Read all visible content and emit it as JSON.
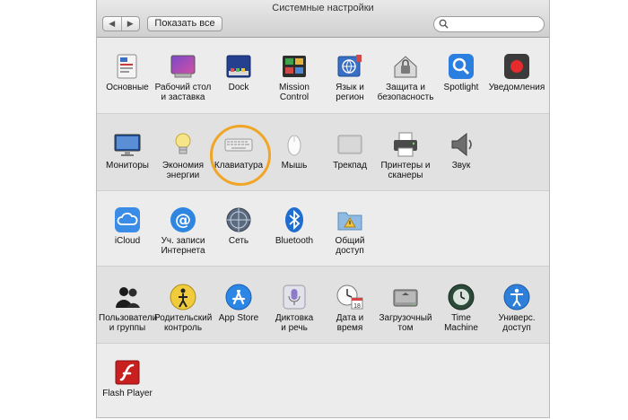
{
  "window": {
    "title": "Системные настройки"
  },
  "toolbar": {
    "back": "◀",
    "forward": "▶",
    "show_all": "Показать все"
  },
  "search": {
    "value": "",
    "placeholder": ""
  },
  "rows": [
    {
      "items": [
        {
          "label": "Основные"
        },
        {
          "label": "Рабочий стол\nи заставка"
        },
        {
          "label": "Dock"
        },
        {
          "label": "Mission\nControl"
        },
        {
          "label": "Язык и\nрегион"
        },
        {
          "label": "Защита и\nбезопасность"
        },
        {
          "label": "Spotlight"
        },
        {
          "label": "Уведомления"
        }
      ]
    },
    {
      "items": [
        {
          "label": "Мониторы"
        },
        {
          "label": "Экономия\nэнергии"
        },
        {
          "label": "Клавиатура"
        },
        {
          "label": "Мышь"
        },
        {
          "label": "Трекпад"
        },
        {
          "label": "Принтеры и\nсканеры"
        },
        {
          "label": "Звук"
        }
      ]
    },
    {
      "items": [
        {
          "label": "iCloud"
        },
        {
          "label": "Уч. записи\nИнтернета"
        },
        {
          "label": "Сеть"
        },
        {
          "label": "Bluetooth"
        },
        {
          "label": "Общий\nдоступ"
        }
      ]
    },
    {
      "items": [
        {
          "label": "Пользователи\nи группы"
        },
        {
          "label": "Родительский\nконтроль"
        },
        {
          "label": "App Store"
        },
        {
          "label": "Диктовка\nи речь"
        },
        {
          "label": "Дата и\nвремя"
        },
        {
          "label": "Загрузочный\nтом"
        },
        {
          "label": "Time\nMachine"
        },
        {
          "label": "Универс.\nдоступ"
        }
      ]
    },
    {
      "items": [
        {
          "label": "Flash Player"
        }
      ]
    }
  ],
  "date_icon": {
    "day": "18"
  },
  "colors": {
    "highlight_ring": "#f0a526",
    "accent_blue": "#2a7fe0"
  }
}
